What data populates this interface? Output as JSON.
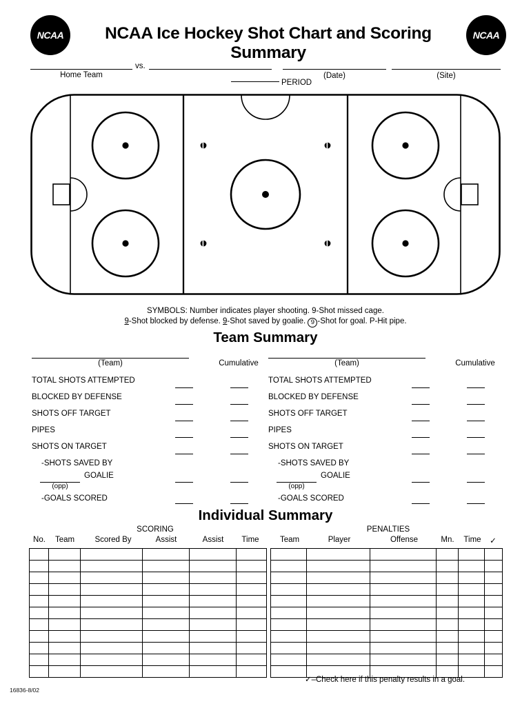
{
  "header": {
    "title": "NCAA Ice Hockey Shot Chart and Scoring Summary",
    "logo_text": "NCAA",
    "logo_left_name": "ncaa-logo-left",
    "logo_right_name": "ncaa-logo-right",
    "home_team_label": "Home Team",
    "vs_label": "vs.",
    "period_label": "PERIOD",
    "date_label": "(Date)",
    "site_label": "(Site)",
    "home_team_value": "",
    "away_team_value": "",
    "period_value": "",
    "date_value": "",
    "site_value": ""
  },
  "symbols": {
    "line1": "SYMBOLS: Number indicates player shooting. 9-Shot missed cage.",
    "line2_a": "9",
    "line2_b": "-Shot blocked by defense. ",
    "line2_c": "9",
    "line2_d": "-Shot saved by goalie. ",
    "line2_e": "9",
    "line2_f": "-Shot for goal. P-Hit pipe."
  },
  "team_summary": {
    "title": "Team Summary",
    "team_caption": "(Team)",
    "cumulative_caption": "Cumulative",
    "opp_caption": "(opp)",
    "rows": [
      {
        "label": "TOTAL SHOTS ATTEMPTED",
        "value": "",
        "cumulative": ""
      },
      {
        "label": "BLOCKED BY DEFENSE",
        "value": "",
        "cumulative": ""
      },
      {
        "label": "SHOTS OFF TARGET",
        "value": "",
        "cumulative": ""
      },
      {
        "label": "PIPES",
        "value": "",
        "cumulative": ""
      },
      {
        "label": "SHOTS ON TARGET",
        "value": "",
        "cumulative": ""
      },
      {
        "label": "-SHOTS SAVED BY",
        "value": "",
        "cumulative": ""
      },
      {
        "label": "GOALIE",
        "value": "",
        "cumulative": ""
      },
      {
        "label": "-GOALS SCORED",
        "value": "",
        "cumulative": ""
      }
    ],
    "left_team_value": "",
    "right_team_value": ""
  },
  "individual_summary": {
    "title": "Individual Summary",
    "scoring": {
      "group_header": "SCORING",
      "columns": [
        "No.",
        "Team",
        "Scored By",
        "Assist",
        "Assist",
        "Time"
      ],
      "row_count": 11
    },
    "penalties": {
      "group_header": "PENALTIES",
      "columns": [
        "Team",
        "Player",
        "Offense",
        "Mn.",
        "Time",
        "✓"
      ],
      "row_count": 11
    },
    "footnote": "✓–Check here if this penalty results in a goal."
  },
  "footer": {
    "form_code": "16836-8/02"
  },
  "colors": {
    "ink": "#000000",
    "paper": "#ffffff"
  }
}
